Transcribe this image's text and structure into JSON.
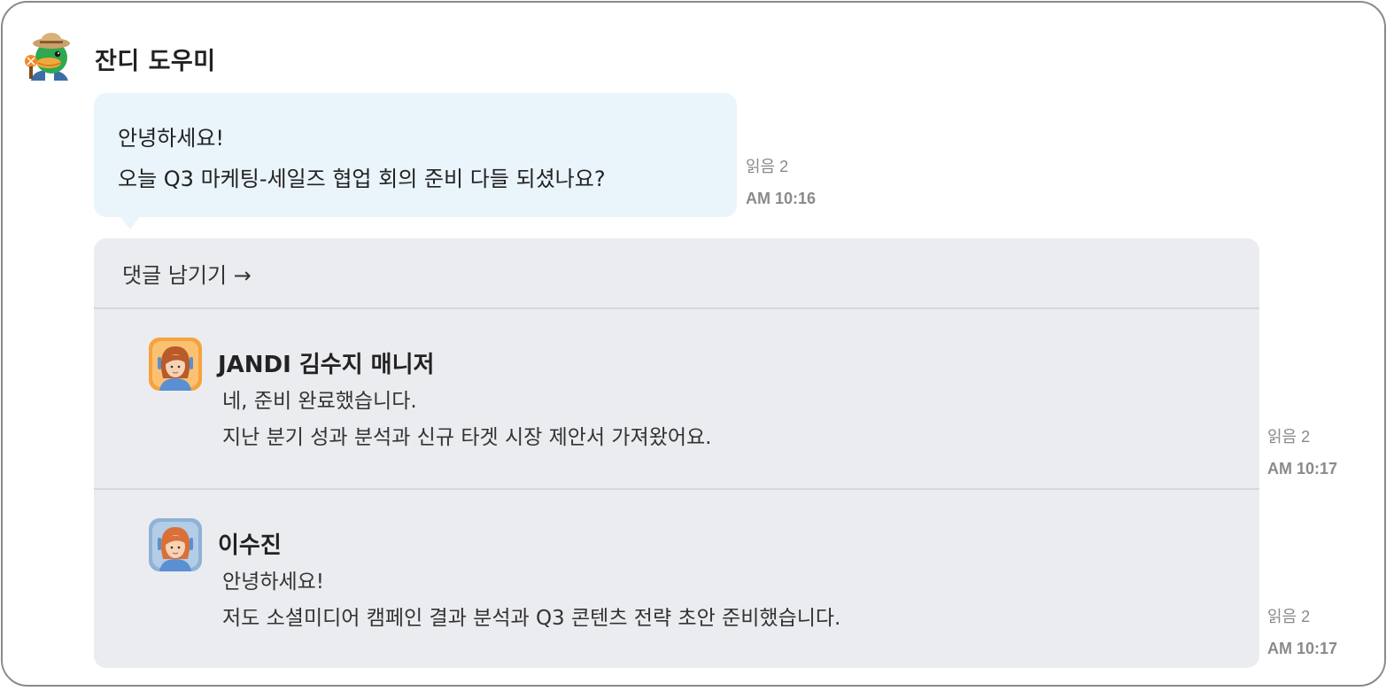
{
  "post": {
    "author": "잔디 도우미",
    "avatar_icon": "duck-mascot-icon",
    "lines": [
      "안녕하세요!",
      "오늘 Q3 마케팅-세일즈 협업 회의 준비 다들 되셨나요?"
    ],
    "read": "읽음 2",
    "time": "AM 10:16"
  },
  "thread": {
    "reply_link": "댓글 남기기 →",
    "comments": [
      {
        "author": "JANDI 김수지 매니저",
        "avatar_icon": "user-avatar-icon",
        "lines": [
          "네, 준비 완료했습니다.",
          "지난 분기 성과 분석과 신규 타겟 시장 제안서 가져왔어요."
        ],
        "read": "읽음 2",
        "time": "AM 10:17"
      },
      {
        "author": "이수진",
        "avatar_icon": "user-avatar-icon",
        "lines": [
          "안녕하세요!",
          "저도 소셜미디어 캠페인 결과 분석과 Q3 콘텐츠 전략 초안 준비했습니다."
        ],
        "read": "읽음 2",
        "time": "AM 10:17"
      }
    ]
  },
  "colors": {
    "bubble_bg": "#eaf4fb",
    "thread_bg": "#ebecf0",
    "meta_text": "#8a8a8a",
    "avatar_orange": "#f6a33c",
    "avatar_blue": "#8fb2d6",
    "mascot_green": "#2fa84f"
  }
}
